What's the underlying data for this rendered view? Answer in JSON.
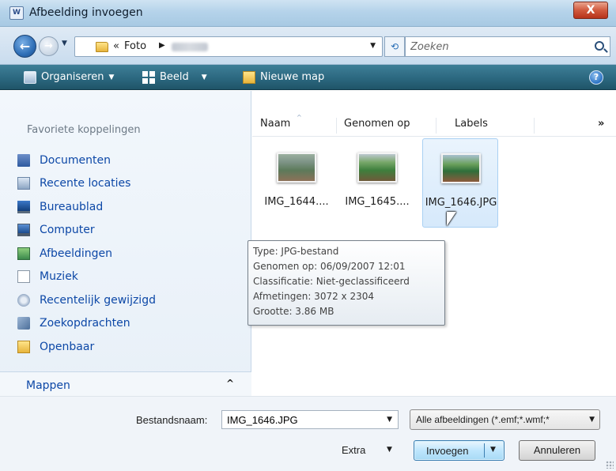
{
  "window": {
    "title": "Afbeelding invoegen",
    "title_icon": "W",
    "close_label": "X"
  },
  "address": {
    "back_icon": "arrow-left-icon",
    "forward_icon": "arrow-right-icon",
    "recent_icon": "chevron-down-icon",
    "lead": "«",
    "crumbs": [
      "Foto",
      "▶"
    ],
    "dropdown": "▼",
    "refresh": "⟲",
    "search_placeholder": "Zoeken"
  },
  "toolbar": {
    "organize": "Organiseren",
    "view": "Beeld",
    "new_folder": "Nieuwe map",
    "arrow": "▼",
    "help": "?"
  },
  "navpane": {
    "header": "Favoriete koppelingen",
    "items": [
      {
        "label": "Documenten",
        "icon": "documents-icon"
      },
      {
        "label": "Recente locaties",
        "icon": "recent-places-icon"
      },
      {
        "label": "Bureaublad",
        "icon": "desktop-icon"
      },
      {
        "label": "Computer",
        "icon": "computer-icon"
      },
      {
        "label": "Afbeeldingen",
        "icon": "pictures-icon"
      },
      {
        "label": "Muziek",
        "icon": "music-icon"
      },
      {
        "label": "Recentelijk gewijzigd",
        "icon": "recently-changed-icon"
      },
      {
        "label": "Zoekopdrachten",
        "icon": "searches-icon"
      },
      {
        "label": "Openbaar",
        "icon": "public-folder-icon"
      }
    ],
    "folders_label": "Mappen",
    "folders_chevron": "^"
  },
  "filelist": {
    "columns": [
      "Naam",
      "Genomen op",
      "Labels"
    ],
    "more_columns": "»",
    "files": [
      {
        "name": "IMG_1644....",
        "selected": false
      },
      {
        "name": "IMG_1645....",
        "selected": false
      },
      {
        "name": "IMG_1646.JPG",
        "selected": true
      }
    ]
  },
  "tooltip": {
    "lines": [
      "Type: JPG-bestand",
      "Genomen op: 06/09/2007 12:01",
      "Classificatie: Niet-geclassificeerd",
      "Afmetingen: 3072 x 2304",
      "Grootte: 3.86 MB"
    ]
  },
  "bottom": {
    "filename_label": "Bestandsnaam:",
    "filename_value": "IMG_1646.JPG",
    "filter_value": "Alle afbeeldingen (*.emf;*.wmf;*",
    "extra_label": "Extra",
    "insert_label": "Invoegen",
    "cancel_label": "Annuleren",
    "dropdown": "▼"
  },
  "colors": {
    "toolbar": "#2d6a82",
    "link": "#0d48a7",
    "selection": "#d6e9fb"
  }
}
